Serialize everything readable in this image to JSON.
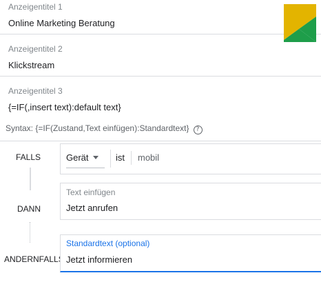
{
  "headlines": [
    {
      "label": "Anzeigentitel 1",
      "value": "Online Marketing Beratung"
    },
    {
      "label": "Anzeigentitel 2",
      "value": "Klickstream"
    },
    {
      "label": "Anzeigentitel 3",
      "value": "{=IF(,insert text):default text}"
    }
  ],
  "syntax": {
    "text": "Syntax: {=IF(Zustand,Text einfügen):Standardtext}",
    "icon": "help-circle-icon"
  },
  "rows": {
    "if_label": "FALLS",
    "then_label": "DANN",
    "else_label": "ANDERNFALLS"
  },
  "condition": {
    "attribute": "Gerät",
    "operator": "ist",
    "value": "mobil"
  },
  "then_field": {
    "label": "Text einfügen",
    "value": "Jetzt anrufen"
  },
  "else_field": {
    "label": "Standardtext (optional)",
    "value": "Jetzt informieren"
  },
  "colors": {
    "accent": "#1a73e8",
    "logo_yellow": "#e3b400",
    "logo_green": "#1e9e4a"
  }
}
